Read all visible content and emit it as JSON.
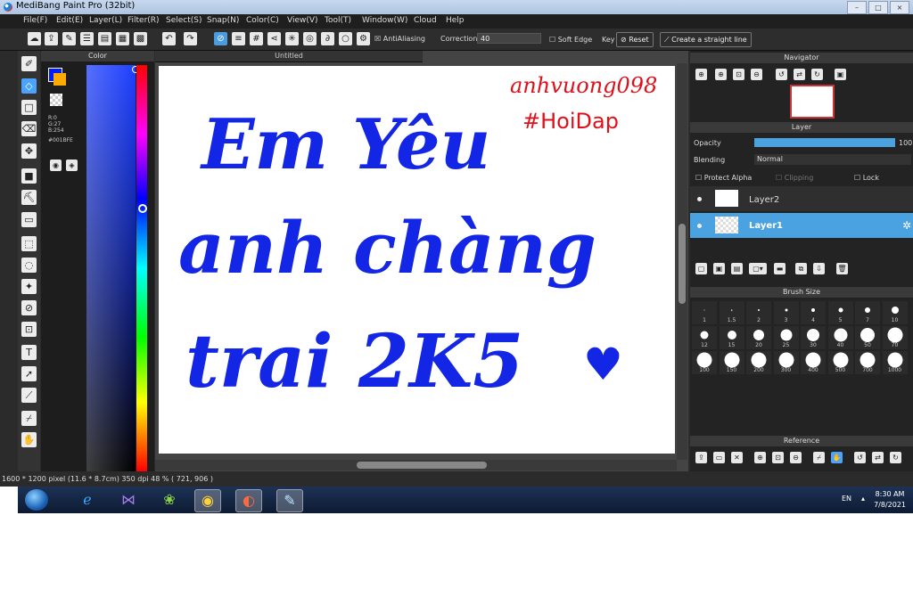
{
  "app": {
    "title": "MediBang Paint Pro (32bit)"
  },
  "window_buttons": {
    "minimize": "–",
    "maximize": "□",
    "close": "×"
  },
  "menu": [
    "File(F)",
    "Edit(E)",
    "Layer(L)",
    "Filter(R)",
    "Select(S)",
    "Snap(N)",
    "Color(C)",
    "View(V)",
    "Tool(T)",
    "Window(W)",
    "Cloud",
    "Help"
  ],
  "toolbar": {
    "antialiasing": "AntiAliasing",
    "correction_label": "Correction",
    "correction_value": "40",
    "soft_edge": "Soft Edge",
    "key_label": "Key",
    "reset": "Reset",
    "straight_line": "Create a straight line"
  },
  "color_panel": {
    "title": "Color",
    "r": "R:0",
    "g": "G:27",
    "b": "B:254",
    "hex": "#001BFE",
    "primary_color": "#001BFE"
  },
  "document": {
    "tab": "Untitled",
    "lines": [
      "Em Yêu",
      "anh chàng",
      "trai 2K5"
    ],
    "heart": "♥",
    "signature_line1": "anhvuong098",
    "signature_line2": "#HoiDap",
    "ink_color": "#1326e6",
    "signature_color": "#e0101a"
  },
  "navigator": {
    "title": "Navigator"
  },
  "layer_panel": {
    "title": "Layer",
    "opacity_label": "Opacity",
    "opacity_value": "100",
    "opacity_percent": 100,
    "blending_label": "Blending",
    "blending_value": "Normal",
    "protect_alpha": "Protect Alpha",
    "clipping": "Clipping",
    "lock": "Lock",
    "layers": [
      {
        "name": "Layer2",
        "selected": false
      },
      {
        "name": "Layer1",
        "selected": true
      }
    ]
  },
  "brush_size": {
    "title": "Brush Size",
    "sizes": [
      "1",
      "1.5",
      "2",
      "3",
      "4",
      "5",
      "7",
      "10",
      "12",
      "15",
      "20",
      "25",
      "30",
      "40",
      "50",
      "70",
      "100",
      "150",
      "200",
      "300",
      "400",
      "500",
      "700",
      "1000"
    ]
  },
  "reference": {
    "title": "Reference"
  },
  "status": {
    "text": "1600 * 1200 pixel  (11.6 * 8.7cm)  350 dpi  48 %  ( 721, 906 )"
  },
  "taskbar": {
    "lang": "EN",
    "time": "8:30 AM",
    "date": "7/8/2021"
  }
}
